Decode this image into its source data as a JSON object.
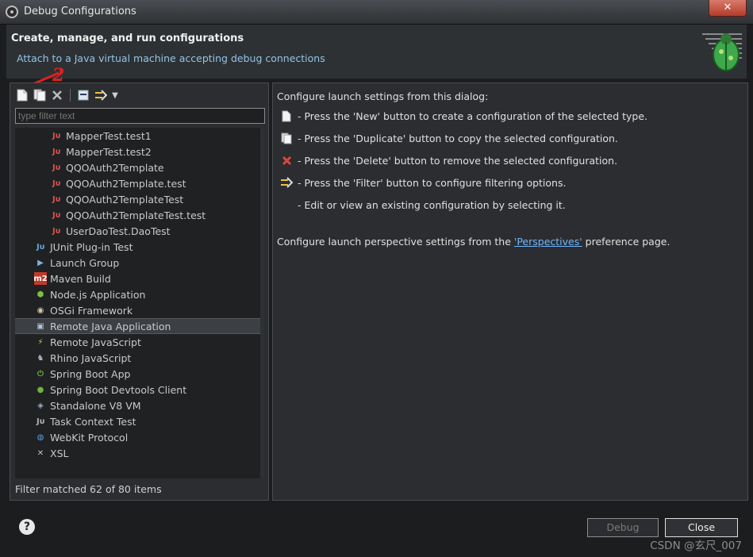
{
  "window": {
    "title": "Debug Configurations",
    "close_glyph": "✕"
  },
  "header": {
    "title": "Create, manage, and run configurations",
    "description": "Attach to a Java virtual machine accepting debug connections"
  },
  "toolbar": {
    "icons": [
      "new-configuration-icon",
      "duplicate-icon",
      "delete-icon",
      "collapse-all-icon",
      "filter-icon",
      "view-menu-icon"
    ]
  },
  "filter": {
    "placeholder": "type filter text"
  },
  "tree": {
    "items": [
      {
        "label": "MapperTest.test1",
        "icon": "junit-icon",
        "level": 2
      },
      {
        "label": "MapperTest.test2",
        "icon": "junit-icon",
        "level": 2
      },
      {
        "label": "QQOAuth2Template",
        "icon": "junit-icon",
        "level": 2
      },
      {
        "label": "QQOAuth2Template.test",
        "icon": "junit-icon",
        "level": 2
      },
      {
        "label": "QQOAuth2TemplateTest",
        "icon": "junit-icon",
        "level": 2
      },
      {
        "label": "QQOAuth2TemplateTest.test",
        "icon": "junit-icon",
        "level": 2
      },
      {
        "label": "UserDaoTest.DaoTest",
        "icon": "junit-icon",
        "level": 2
      },
      {
        "label": "JUnit Plug-in Test",
        "icon": "junit-plugin-icon",
        "level": 1
      },
      {
        "label": "Launch Group",
        "icon": "launch-group-icon",
        "level": 1
      },
      {
        "label": "Maven Build",
        "icon": "maven-icon",
        "level": 1
      },
      {
        "label": "Node.js Application",
        "icon": "nodejs-icon",
        "level": 1
      },
      {
        "label": "OSGi Framework",
        "icon": "osgi-icon",
        "level": 1
      },
      {
        "label": "Remote Java Application",
        "icon": "remote-java-icon",
        "level": 1,
        "selected": true
      },
      {
        "label": "Remote JavaScript",
        "icon": "remote-javascript-icon",
        "level": 1
      },
      {
        "label": "Rhino JavaScript",
        "icon": "rhino-icon",
        "level": 1
      },
      {
        "label": "Spring Boot App",
        "icon": "spring-boot-icon",
        "level": 1
      },
      {
        "label": "Spring Boot Devtools Client",
        "icon": "spring-devtools-icon",
        "level": 1
      },
      {
        "label": "Standalone V8 VM",
        "icon": "v8-icon",
        "level": 1
      },
      {
        "label": "Task Context Test",
        "icon": "task-context-icon",
        "level": 1
      },
      {
        "label": "WebKit Protocol",
        "icon": "webkit-icon",
        "level": 1
      },
      {
        "label": "XSL",
        "icon": "xsl-icon",
        "level": 1
      }
    ],
    "status": "Filter matched 62 of 80 items"
  },
  "right": {
    "intro": "Configure launch settings from this dialog:",
    "lines": [
      {
        "icon": "new-icon",
        "text": "- Press the 'New' button to create a configuration of the selected type."
      },
      {
        "icon": "duplicate-icon",
        "text": "- Press the 'Duplicate' button to copy the selected configuration."
      },
      {
        "icon": "delete-icon",
        "text": "- Press the 'Delete' button to remove the selected configuration."
      },
      {
        "icon": "filter-icon",
        "text": "- Press the 'Filter' button to configure filtering options."
      },
      {
        "icon": "",
        "text": "- Edit or view an existing configuration by selecting it."
      }
    ],
    "perspective_prefix": "Configure launch perspective settings from the ",
    "perspective_link": "'Perspectives'",
    "perspective_suffix": " preference page."
  },
  "buttons": {
    "help": "?",
    "debug": "Debug",
    "close": "Close"
  },
  "annotations": {
    "mark_2": "2"
  },
  "watermark": "CSDN @玄尺_007",
  "colors": {
    "accent_link": "#6fb7ff",
    "header_desc": "#8fc5e8",
    "annotation": "#e02020",
    "background": "#1c1d1f"
  }
}
